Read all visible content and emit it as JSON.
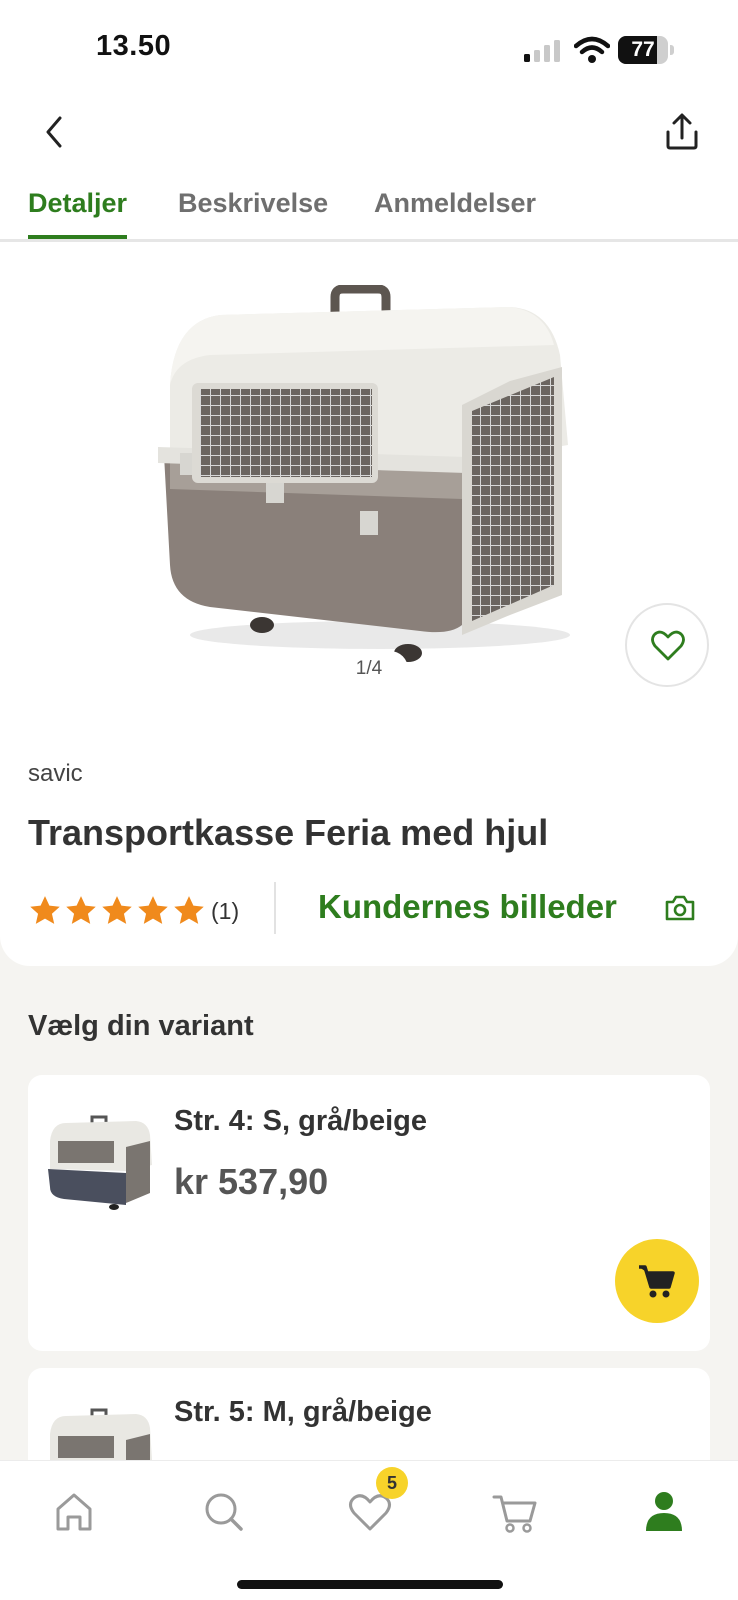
{
  "status_bar": {
    "time": "13.50",
    "battery_level": "77",
    "battery_fraction": 0.77
  },
  "tabs": [
    {
      "label": "Detaljer",
      "active": true
    },
    {
      "label": "Beskrivelse",
      "active": false
    },
    {
      "label": "Anmeldelser",
      "active": false
    }
  ],
  "gallery": {
    "pager": "1/4"
  },
  "product": {
    "brand": "savic",
    "title": "Transportkasse Feria med hjul",
    "rating_stars": 5,
    "review_count": "(1)",
    "customer_photos_link": "Kundernes billeder"
  },
  "variants": {
    "heading": "Vælg din variant",
    "items": [
      {
        "name": "Str. 4: S, grå/beige",
        "price": "kr 537,90"
      },
      {
        "name": "Str. 5: M, grå/beige",
        "price": ""
      }
    ]
  },
  "bottom_nav": {
    "items": [
      "home-icon",
      "search-icon",
      "heart-icon",
      "cart-icon",
      "profile-icon"
    ],
    "favorites_badge": "5"
  },
  "colors": {
    "brand_green": "#2e7d1e",
    "accent_yellow": "#f7d32a",
    "star_orange": "#f08a1c",
    "background": "#f5f4f1"
  }
}
